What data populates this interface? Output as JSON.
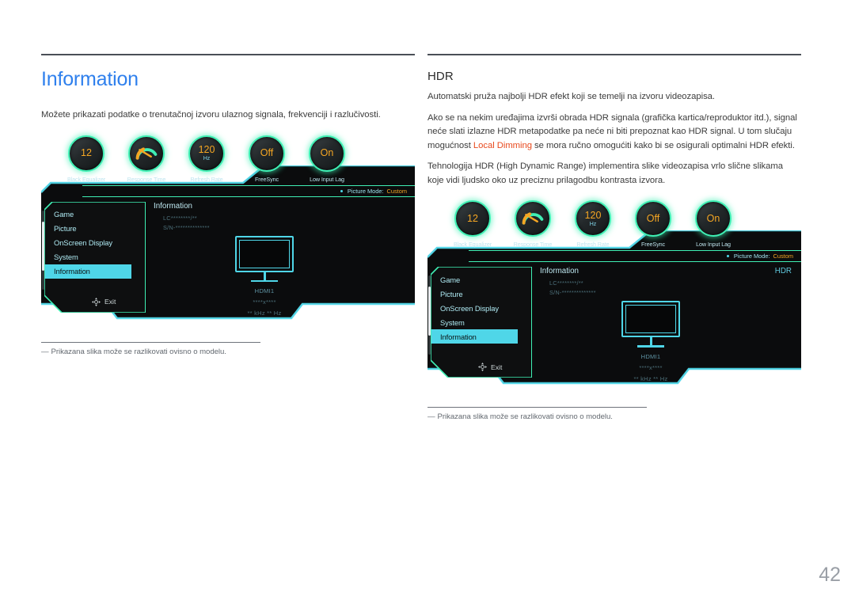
{
  "page": {
    "number": "42"
  },
  "left_column": {
    "title": "Information",
    "intro": "Možete prikazati podatke o trenutačnoj izvoru ulaznog signala, frekvenciji i razlučivosti.",
    "footnote_dash": "―",
    "footnote": "Prikazana slika može se razlikovati ovisno o modelu."
  },
  "right_column": {
    "title": "HDR",
    "paragraphs": [
      "Automatski pruža najbolji HDR efekt koji se temelji na izvoru videozapisa.",
      "Tehnologija HDR (High Dynamic Range) implementira slike videozapisa vrlo slične slikama koje vidi ljudsko oko uz preciznu prilagodbu kontrasta izvora."
    ],
    "paragraph2": {
      "part1": "Ako se na nekim uređajima izvrši obrada HDR signala (grafička kartica/reproduktor itd.), signal neće slati izlazne HDR metapodatke pa neće ni biti prepoznat kao HDR signal. U tom slučaju mogućnost ",
      "highlight": "Local Dimming",
      "part2": " se mora ručno omogućiti kako bi se osigurali optimalni HDR efekti."
    },
    "footnote_dash": "―",
    "footnote": "Prikazana slika može se razlikovati ovisno o modelu."
  },
  "osd": {
    "knobs": [
      {
        "value": "12",
        "unit": "",
        "label": "Black Equalizer",
        "type": "value"
      },
      {
        "value": "",
        "unit": "",
        "label": "Response Time",
        "type": "gauge"
      },
      {
        "value": "120",
        "unit": "Hz",
        "label": "Refresh Rate",
        "type": "value"
      },
      {
        "value": "Off",
        "unit": "",
        "label": "FreeSync",
        "type": "value"
      },
      {
        "value": "On",
        "unit": "",
        "label": "Low Input Lag",
        "type": "value"
      }
    ],
    "picture_mode_label": "Picture Mode:",
    "picture_mode_value": "Custom",
    "menu_items": [
      {
        "label": "Game",
        "selected": false
      },
      {
        "label": "Picture",
        "selected": false
      },
      {
        "label": "OnScreen Display",
        "selected": false
      },
      {
        "label": "System",
        "selected": false
      },
      {
        "label": "Information",
        "selected": true
      }
    ],
    "exit_label": "Exit",
    "content_title": "Information",
    "content_hdr_left": "",
    "content_hdr_right": "HDR",
    "model_line": "LC********/**",
    "serial_line": "S/N-**************",
    "source": "HDMI1",
    "resolution": "****x****",
    "frequency": "** kHz ** Hz"
  },
  "colors": {
    "accent_blue": "#2f80ed",
    "highlight_orange": "#e8491d",
    "osd_green": "#3ff0b4",
    "osd_cyan": "#4fd6e8",
    "osd_amber": "#f5a623"
  }
}
